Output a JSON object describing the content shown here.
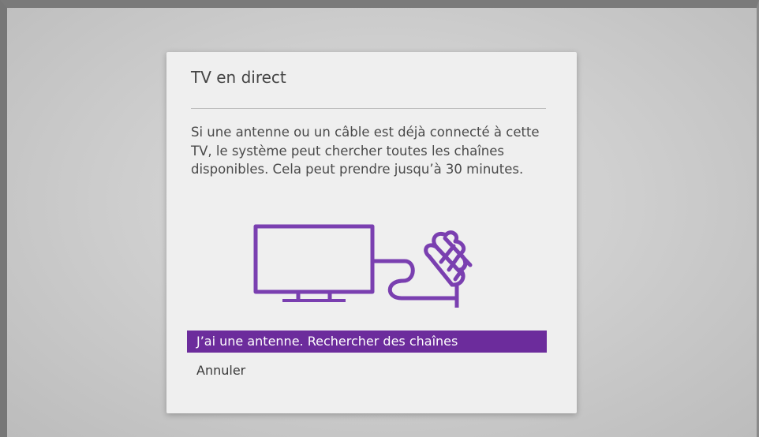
{
  "dialog": {
    "title": "TV en direct",
    "description": "Si une antenne ou un câble est déjà connecté à cette TV, le système peut chercher toutes les chaînes disponibles. Cela peut prendre jusqu’à 30 minutes.",
    "illustration_icons": [
      "tv-icon",
      "antenna-icon"
    ],
    "accent_color": "#6c2c9c",
    "illustration_color": "#7a3fb0"
  },
  "menu": {
    "items": [
      {
        "label": "J’ai une antenne. Rechercher des chaînes",
        "selected": true
      },
      {
        "label": "Annuler",
        "selected": false
      }
    ]
  }
}
